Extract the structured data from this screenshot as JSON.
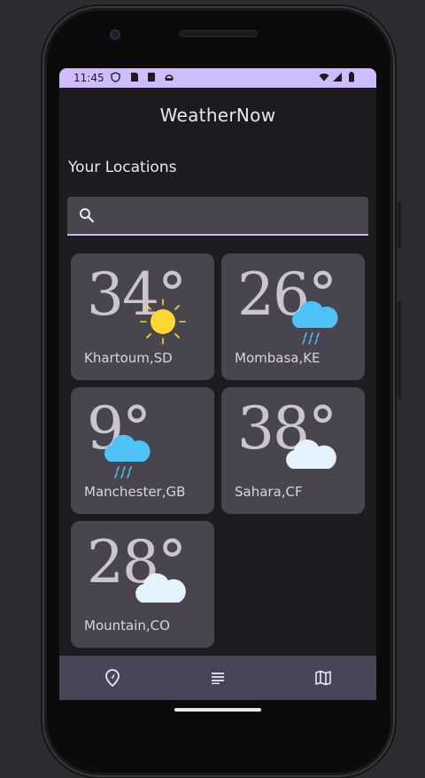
{
  "status": {
    "time": "11:45"
  },
  "app": {
    "title": "WeatherNow"
  },
  "section": {
    "title": "Your Locations"
  },
  "search": {
    "value": "",
    "placeholder": ""
  },
  "locations": [
    {
      "temp": "34°",
      "city": "Khartoum,SD",
      "icon": "sun-icon"
    },
    {
      "temp": "26°",
      "city": "Mombasa,KE",
      "icon": "rain-cloud-icon"
    },
    {
      "temp": "9°",
      "city": "Manchester,GB",
      "icon": "rain-cloud-icon"
    },
    {
      "temp": "38°",
      "city": "Sahara,CF",
      "icon": "cloud-icon"
    },
    {
      "temp": "28°",
      "city": "Mountain,CO",
      "icon": "cloud-icon"
    }
  ],
  "nav": [
    {
      "icon": "location-icon"
    },
    {
      "icon": "list-icon"
    },
    {
      "icon": "map-icon"
    }
  ],
  "colors": {
    "status_bar": "#d1bcfb",
    "background": "#1d1b20",
    "card": "#49454f",
    "nav_bar": "#4a4459",
    "sun": "#fdd835",
    "rain_cloud": "#4fc3f7",
    "cloud": "#e3f2fd"
  }
}
